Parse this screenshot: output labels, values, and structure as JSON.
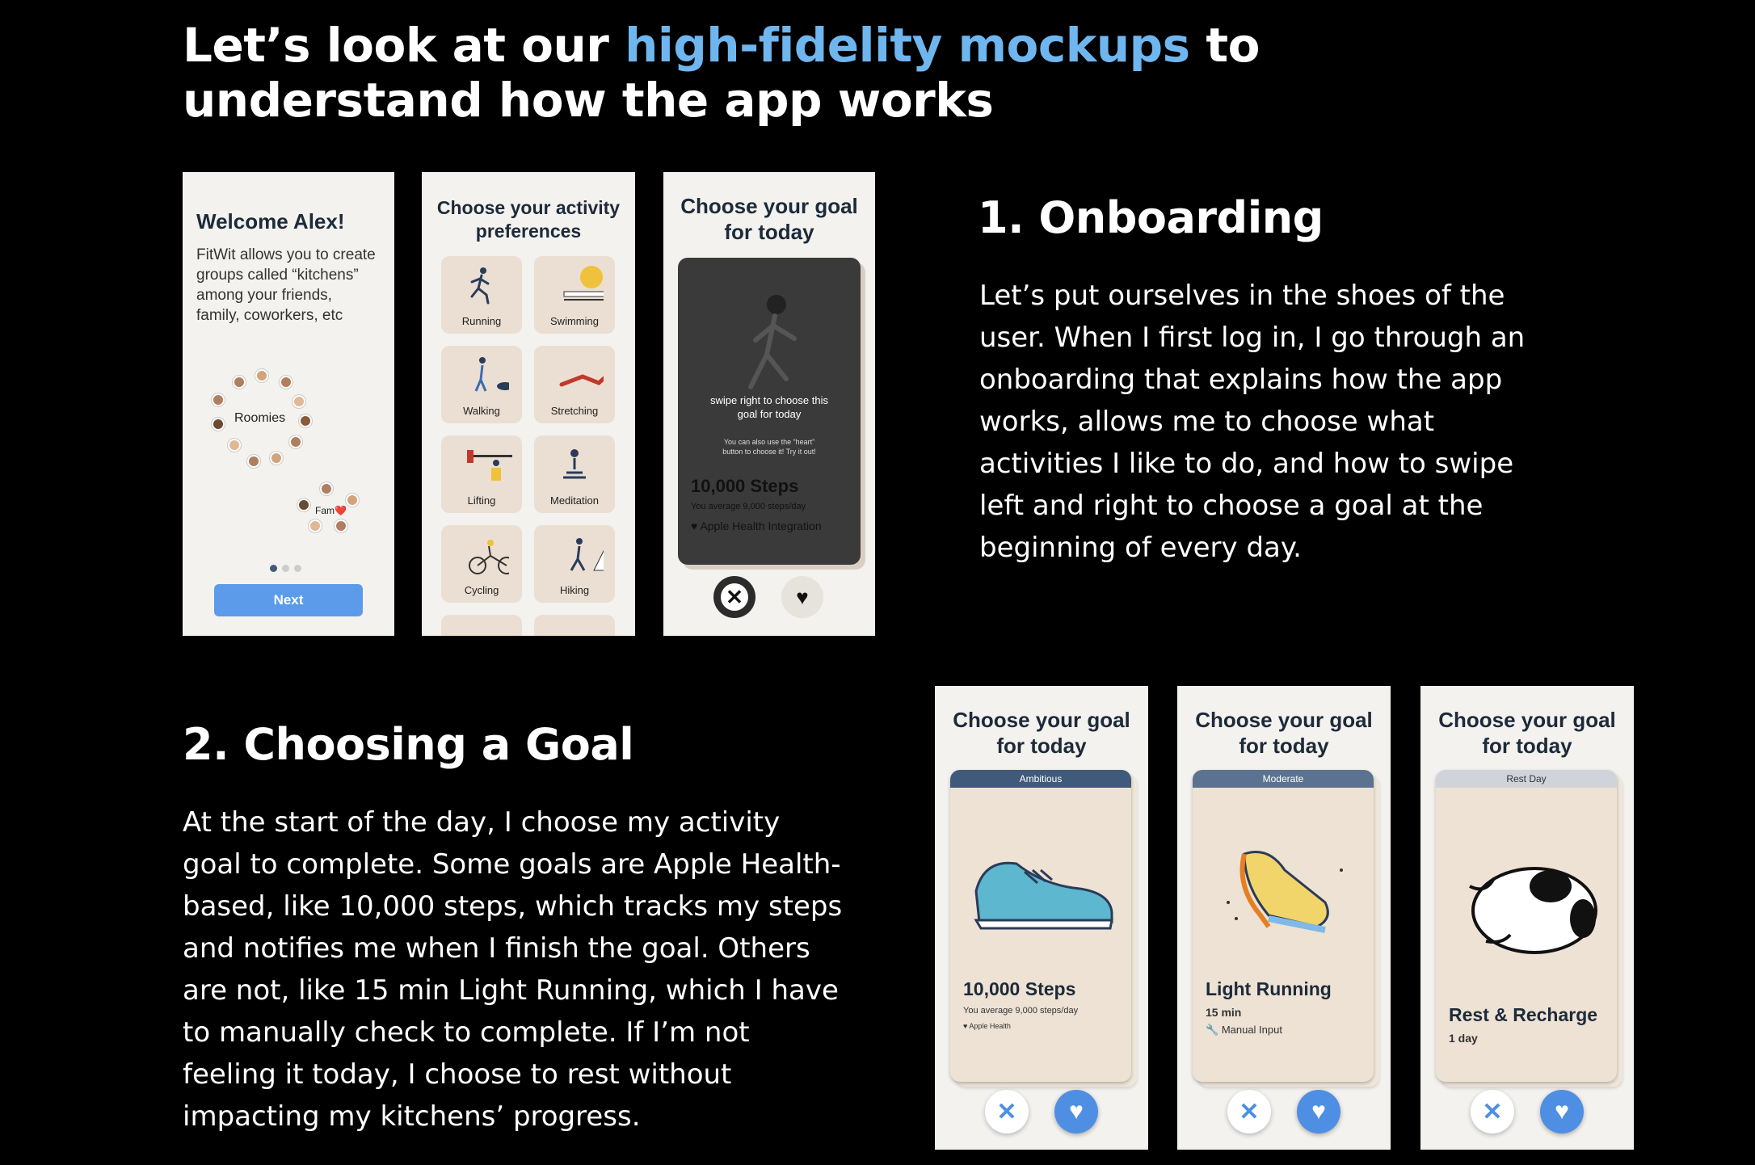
{
  "headline": {
    "part1": "Let’s look at our ",
    "highlight": "high-fidelity mockups",
    "part2": " to understand how the app works"
  },
  "onboarding": {
    "title": "1. Onboarding",
    "body": "Let’s put ourselves in the shoes of the user. When I first log in, I go through an onboarding that explains how the app works, allows me to choose what activities I like to do, and how to swipe left and right to choose a goal at the beginning of every day."
  },
  "goal_section": {
    "title": "2. Choosing a Goal",
    "body": "At the start of the day, I choose my activity goal to complete. Some goals are Apple Health-based, like 10,000 steps, which tracks my steps and notifies me when I finish the goal. Others are not, like 15 min Light Running, which I have to manually check to complete. If I’m not feeling it today, I choose to rest without impacting my kitchens’ progress."
  },
  "phone1": {
    "title": "Welcome Alex!",
    "desc": "FitWit allows you to create groups called “kitchens” among your friends, family, coworkers, etc",
    "group1": "Roomies",
    "group2": "Fam❤️",
    "next": "Next"
  },
  "phone2": {
    "title": "Choose your activity preferences",
    "activities": [
      "Running",
      "Swimming",
      "Walking",
      "Stretching",
      "Lifting",
      "Meditation",
      "Cycling",
      "Hiking"
    ]
  },
  "phone3": {
    "title": "Choose your goal for today",
    "hint": "swipe right to choose this goal for today",
    "sub": "You can also use the “heart” button to choose it! Try it out!",
    "steps": "10,000 Steps",
    "avg": "You average 9,000 steps/day",
    "health": "Apple Health Integration"
  },
  "goals": [
    {
      "title": "Choose your goal for today",
      "tag": "Ambitious",
      "name": "10,000 Steps",
      "sub1": "You average 9,000 steps/day",
      "sub2": "Apple Health"
    },
    {
      "title": "Choose your goal for today",
      "tag": "Moderate",
      "name": "Light Running",
      "sub1": "15 min",
      "sub2": "Manual Input"
    },
    {
      "title": "Choose your goal for today",
      "tag": "Rest Day",
      "name": "Rest & Recharge",
      "sub1": "1 day"
    }
  ],
  "colors": {
    "accent": "#6fb6ef",
    "button_blue": "#5b9bea",
    "heart_blue": "#4f8fe3",
    "tag_ambitious": "#3f5a7a",
    "tag_moderate": "#5b7391",
    "tag_rest": "#cfd4da"
  }
}
